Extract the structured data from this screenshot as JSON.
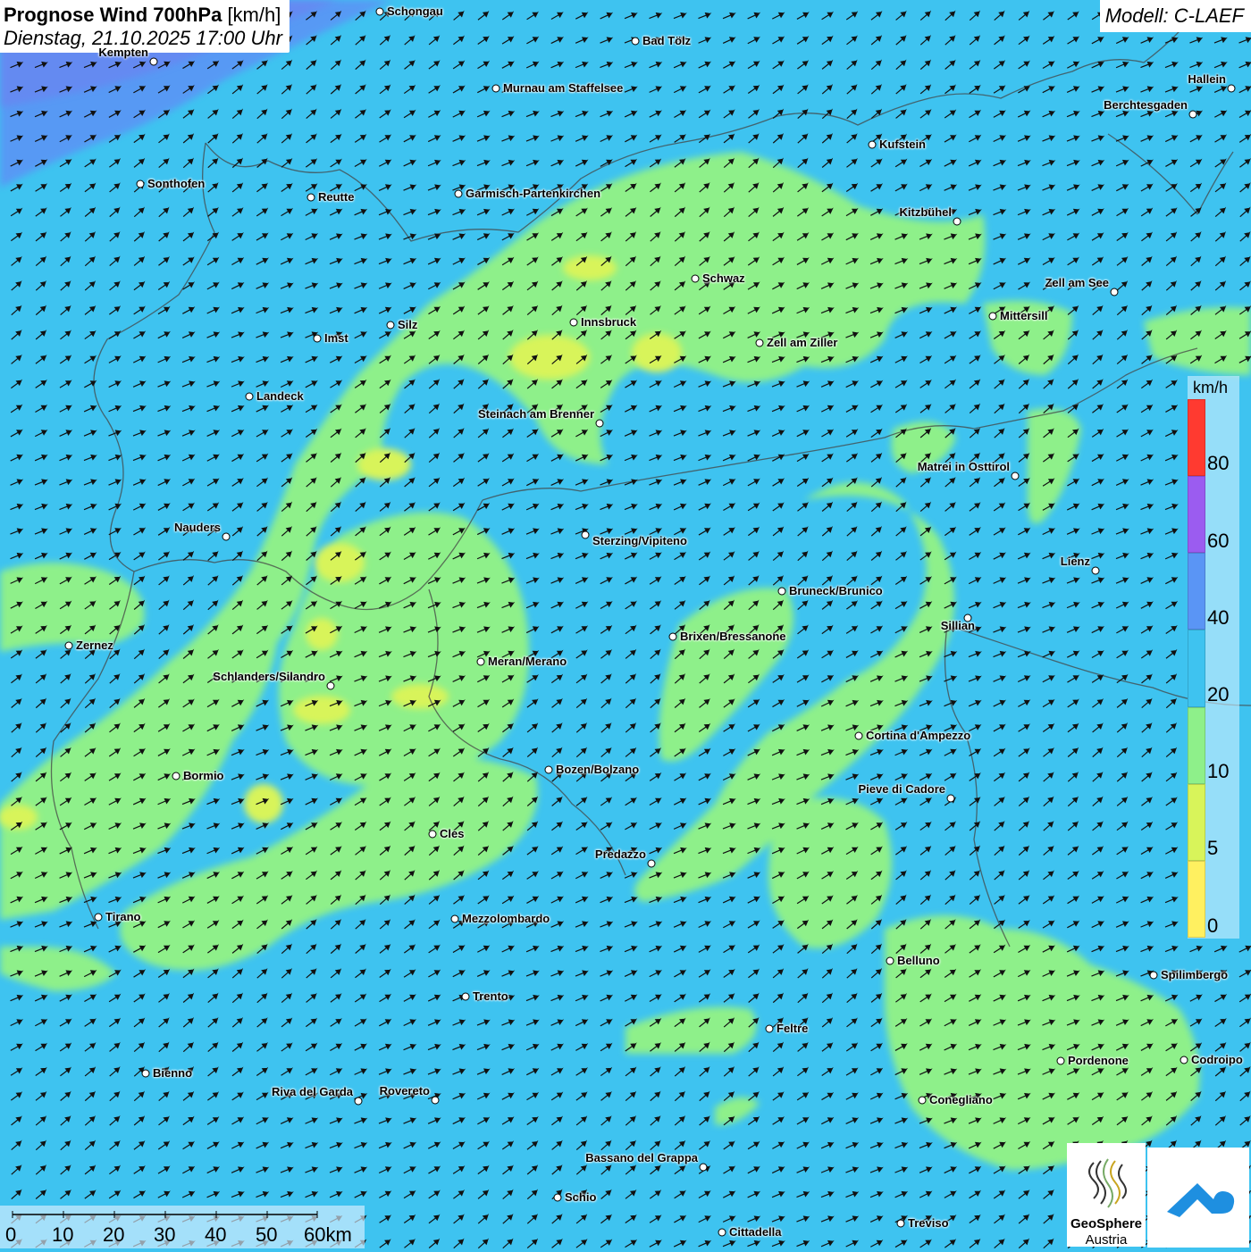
{
  "header": {
    "title_bold": "Prognose Wind 700hPa",
    "title_unit": "[km/h]",
    "subtitle": "Dienstag, 21.10.2025 17:00 Uhr",
    "model": "Modell: C-LAEF"
  },
  "legend": {
    "unit": "km/h",
    "levels": [
      "80",
      "60",
      "40",
      "20",
      "10",
      "5",
      "0"
    ],
    "colors": [
      "#ff3a30",
      "#9b5cf0",
      "#5a95f5",
      "#3ec3f0",
      "#8ef08a",
      "#d8f45a",
      "#fff060"
    ]
  },
  "scale_bar": {
    "labels": [
      "0",
      "10",
      "20",
      "30",
      "40",
      "50",
      "60km"
    ]
  },
  "logos": {
    "geosphere_line1": "GeoSphere",
    "geosphere_line2": "Austria",
    "geosphere_icon": "geosphere-swirl-icon",
    "right_icon": "cloud-arrow-icon"
  },
  "colors": {
    "base_wind_20_40": "#3ec3f0",
    "wind_10_20": "#8ef08a",
    "wind_5_10": "#d8f45a",
    "wind_40_60": "#5a95f5"
  },
  "cities": [
    {
      "name": "Schongau"
    },
    {
      "name": "Bad Tölz"
    },
    {
      "name": "Kempten"
    },
    {
      "name": "Murnau am Staffelsee"
    },
    {
      "name": "Hallein"
    },
    {
      "name": "Berchtesgaden"
    },
    {
      "name": "Kufstein"
    },
    {
      "name": "Sonthofen"
    },
    {
      "name": "Reutte"
    },
    {
      "name": "Garmisch-Partenkirchen"
    },
    {
      "name": "Kitzbühel"
    },
    {
      "name": "Schwaz"
    },
    {
      "name": "Zell am See"
    },
    {
      "name": "Mittersill"
    },
    {
      "name": "Innsbruck"
    },
    {
      "name": "Imst"
    },
    {
      "name": "Silz"
    },
    {
      "name": "Zell am Ziller"
    },
    {
      "name": "Landeck"
    },
    {
      "name": "Steinach am Brenner"
    },
    {
      "name": "Matrei in Osttirol"
    },
    {
      "name": "Nauders"
    },
    {
      "name": "Sterzing/Vipiteno"
    },
    {
      "name": "Lienz"
    },
    {
      "name": "Bruneck/Brunico"
    },
    {
      "name": "Sillian"
    },
    {
      "name": "Brixen/Bressanone"
    },
    {
      "name": "Zernez"
    },
    {
      "name": "Meran/Merano"
    },
    {
      "name": "Schlanders/Silandro"
    },
    {
      "name": "Cortina d'Ampezzo"
    },
    {
      "name": "Bozen/Bolzano"
    },
    {
      "name": "Bormio"
    },
    {
      "name": "Pieve di Cadore"
    },
    {
      "name": "Cles"
    },
    {
      "name": "Predazzo"
    },
    {
      "name": "Tirano"
    },
    {
      "name": "Mezzolombardo"
    },
    {
      "name": "Belluno"
    },
    {
      "name": "Spilimbergo"
    },
    {
      "name": "Trento"
    },
    {
      "name": "Feltre"
    },
    {
      "name": "Pordenone"
    },
    {
      "name": "Codroipo"
    },
    {
      "name": "Bienno"
    },
    {
      "name": "Riva del Garda"
    },
    {
      "name": "Rovereto"
    },
    {
      "name": "Conegliano"
    },
    {
      "name": "Bassano del Grappa"
    },
    {
      "name": "Schio"
    },
    {
      "name": "Treviso"
    },
    {
      "name": "Cittadella"
    }
  ]
}
